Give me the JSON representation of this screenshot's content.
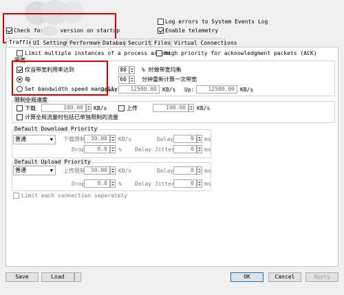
{
  "top": {
    "check_new_version": "Check for new version on startup",
    "log_errors": "Log errors to System Events Log",
    "enable_telemetry": "Enable telemetry"
  },
  "tabs": [
    "Traffic",
    "UI Settings",
    "Performance",
    "Database",
    "Security",
    "Files",
    "Virtual Connections"
  ],
  "options": {
    "limit_instances": "Limit multiple instances of a process as one",
    "high_priority_ack": "High priority for acknowledgment packets (ACK)"
  },
  "bandwidth": {
    "title": "带宽",
    "only_when_reaches": "仅当带宽利用率达到",
    "pct_value": "80",
    "pct_suffix": "% 时做带宽均衡",
    "every": "每",
    "minutes_value": "60",
    "minutes_suffix": "分钟重新计算一次带宽",
    "set_manually": "Set bandwidth speed manually",
    "down_label": "Down:",
    "down_value": "12500.00",
    "down_unit": "KB/s",
    "up_label": "Up:",
    "up_value": "12500.00",
    "up_unit": "KB/s"
  },
  "global_limit": {
    "title": "限制全局速度",
    "download": "下载",
    "download_value": "100.00",
    "download_unit": "KB/s",
    "upload": "上传",
    "upload_value": "100.00",
    "upload_unit": "KB/s",
    "calc_global": "计算全局流量时包括已单独限制的流量"
  },
  "download_priority": {
    "title": "Default Download Priority",
    "priority": "普通",
    "dl_limit_label": "下载限制",
    "dl_limit_value": "30.00",
    "dl_limit_unit": "KB/s",
    "delay_label": "Delay",
    "delay_value": "0",
    "delay_unit": "ms",
    "drop_label": "Drop",
    "drop_value": "0.0",
    "drop_unit": "%",
    "jitter_label": "Delay Jitter.",
    "jitter_value": "0",
    "jitter_unit": "ms"
  },
  "upload_priority": {
    "title": "Default Upload Priority",
    "priority": "普通",
    "ul_limit_label": "上传限制",
    "ul_limit_value": "30.00",
    "ul_limit_unit": "KB/s",
    "delay_label": "Delay",
    "delay_value": "0",
    "delay_unit": "ms",
    "drop_label": "Drop",
    "drop_value": "0.0",
    "drop_unit": "%",
    "jitter_label": "Delay Jitter.",
    "jitter_value": "0",
    "jitter_unit": "ms"
  },
  "limit_each_connection": "Limit each connection separately",
  "buttons": {
    "save": "Save",
    "load": "Load",
    "ok": "OK",
    "cancel": "Cancel",
    "apply": "Apply"
  },
  "colors": {
    "highlight": "#d40000",
    "accent": "#0078d7"
  }
}
